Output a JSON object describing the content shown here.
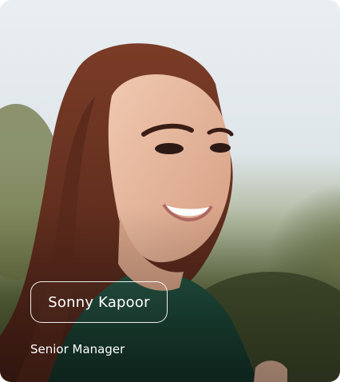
{
  "profile": {
    "name": "Sonny Kapoor",
    "title": "Senior Manager"
  },
  "photo": {
    "subject": "smiling woman with long brown hair in green top, outdoors"
  },
  "colors": {
    "sky": "#e3e9ee",
    "foliage": "#6a7546",
    "hair": "#6b3322",
    "skin": "#e7bca3",
    "shirt": "#1f4a3a",
    "text": "#ffffff"
  }
}
